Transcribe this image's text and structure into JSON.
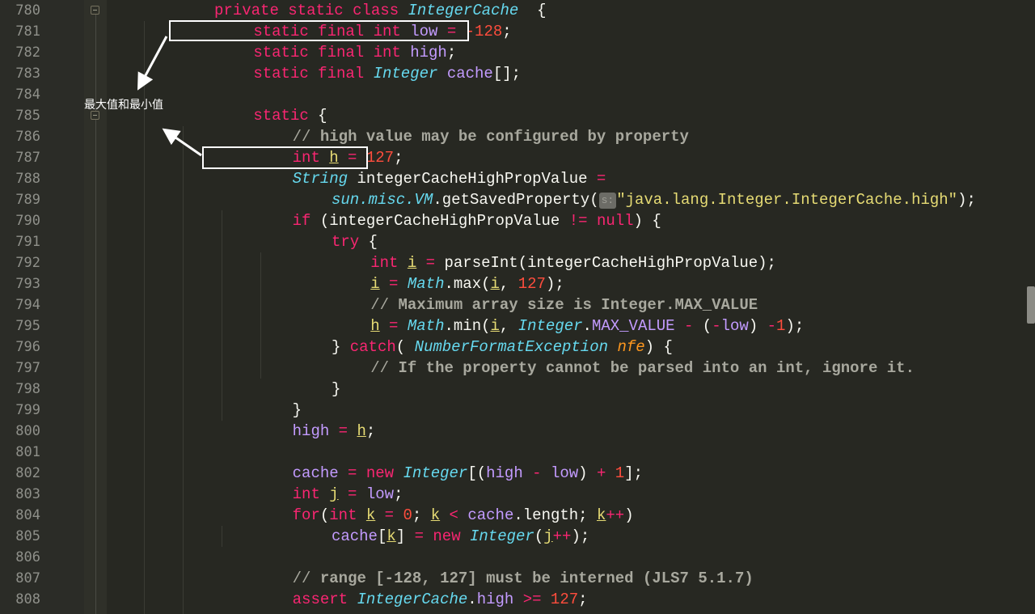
{
  "editor": {
    "first_line": 780,
    "annotation": "最大值和最小值",
    "lines": [
      {
        "n": "780",
        "ind": 7,
        "t": [
          [
            "kw",
            "private "
          ],
          [
            "kw",
            "static "
          ],
          [
            "kw",
            "class "
          ],
          [
            "ty",
            "IntegerCache"
          ],
          [
            "",
            "  {"
          ]
        ]
      },
      {
        "n": "781",
        "ind": 9,
        "t": [
          [
            "kw",
            "static "
          ],
          [
            "kw",
            "final "
          ],
          [
            "kw",
            "int "
          ],
          [
            "fld",
            "low"
          ],
          [
            "op",
            " = "
          ],
          [
            "num",
            "-128"
          ],
          [
            "",
            ";"
          ]
        ]
      },
      {
        "n": "782",
        "ind": 9,
        "t": [
          [
            "kw",
            "static "
          ],
          [
            "kw",
            "final "
          ],
          [
            "kw",
            "int "
          ],
          [
            "fld",
            "high"
          ],
          [
            "",
            ";"
          ]
        ]
      },
      {
        "n": "783",
        "ind": 9,
        "t": [
          [
            "kw",
            "static "
          ],
          [
            "kw",
            "final "
          ],
          [
            "ty",
            "Integer"
          ],
          [
            "",
            " "
          ],
          [
            "fld",
            "cache"
          ],
          [
            "",
            "[];"
          ]
        ]
      },
      {
        "n": "784",
        "ind": 0,
        "t": []
      },
      {
        "n": "785",
        "ind": 9,
        "t": [
          [
            "kw",
            "static"
          ],
          [
            "",
            " {"
          ]
        ]
      },
      {
        "n": "786",
        "ind": 11,
        "t": [
          [
            "cm-sl",
            "// "
          ],
          [
            "cm",
            "high value may be configured by property"
          ]
        ]
      },
      {
        "n": "787",
        "ind": 11,
        "t": [
          [
            "kw",
            "int "
          ],
          [
            "loc",
            "h"
          ],
          [
            "op",
            " = "
          ],
          [
            "num",
            "127"
          ],
          [
            "",
            ";"
          ]
        ]
      },
      {
        "n": "788",
        "ind": 11,
        "t": [
          [
            "ty",
            "String"
          ],
          [
            "",
            " integerCacheHighPropValue "
          ],
          [
            "op",
            "="
          ]
        ]
      },
      {
        "n": "789",
        "ind": 13,
        "t": [
          [
            "ty",
            "sun.misc.VM"
          ],
          [
            "",
            ".getSavedProperty("
          ],
          [
            "hint",
            "s:"
          ],
          [
            "str",
            "\"java.lang.Integer.IntegerCache.high\""
          ],
          [
            "",
            ");"
          ]
        ]
      },
      {
        "n": "790",
        "ind": 11,
        "t": [
          [
            "kw",
            "if"
          ],
          [
            "",
            " (integerCacheHighPropValue "
          ],
          [
            "op",
            "!="
          ],
          [
            "",
            " "
          ],
          [
            "kw",
            "null"
          ],
          [
            "",
            ") {"
          ]
        ]
      },
      {
        "n": "791",
        "ind": 13,
        "t": [
          [
            "kw",
            "try"
          ],
          [
            "",
            " {"
          ]
        ]
      },
      {
        "n": "792",
        "ind": 15,
        "t": [
          [
            "kw",
            "int "
          ],
          [
            "loc",
            "i"
          ],
          [
            "op",
            " = "
          ],
          [
            "",
            "parseInt(integerCacheHighPropValue);"
          ]
        ]
      },
      {
        "n": "793",
        "ind": 15,
        "t": [
          [
            "loc",
            "i"
          ],
          [
            "op",
            " = "
          ],
          [
            "ty",
            "Math"
          ],
          [
            "",
            ".max("
          ],
          [
            "loc",
            "i"
          ],
          [
            "",
            ", "
          ],
          [
            "num",
            "127"
          ],
          [
            "",
            ");"
          ]
        ]
      },
      {
        "n": "794",
        "ind": 15,
        "t": [
          [
            "cm-sl",
            "// "
          ],
          [
            "cm",
            "Maximum array size is Integer.MAX_VALUE"
          ]
        ]
      },
      {
        "n": "795",
        "ind": 15,
        "t": [
          [
            "loc",
            "h"
          ],
          [
            "op",
            " = "
          ],
          [
            "ty",
            "Math"
          ],
          [
            "",
            ".min("
          ],
          [
            "loc",
            "i"
          ],
          [
            "",
            ", "
          ],
          [
            "ty",
            "Integer"
          ],
          [
            "",
            "."
          ],
          [
            "fld",
            "MAX_VALUE"
          ],
          [
            "op",
            " - "
          ],
          [
            "",
            "("
          ],
          [
            "op",
            "-"
          ],
          [
            "fld",
            "low"
          ],
          [
            "",
            ") "
          ],
          [
            "op",
            "-"
          ],
          [
            "num",
            "1"
          ],
          [
            "",
            ");"
          ]
        ]
      },
      {
        "n": "796",
        "ind": 13,
        "t": [
          [
            "",
            "} "
          ],
          [
            "kw",
            "catch"
          ],
          [
            "",
            "( "
          ],
          [
            "ty",
            "NumberFormatException"
          ],
          [
            "",
            " "
          ],
          [
            "par",
            "nfe"
          ],
          [
            "",
            ") {"
          ]
        ]
      },
      {
        "n": "797",
        "ind": 15,
        "t": [
          [
            "cm-sl",
            "// "
          ],
          [
            "cm",
            "If the property cannot be parsed into an int, ignore it."
          ]
        ]
      },
      {
        "n": "798",
        "ind": 13,
        "t": [
          [
            "",
            "}"
          ]
        ]
      },
      {
        "n": "799",
        "ind": 11,
        "t": [
          [
            "",
            "}"
          ]
        ]
      },
      {
        "n": "800",
        "ind": 11,
        "t": [
          [
            "fld",
            "high"
          ],
          [
            "op",
            " = "
          ],
          [
            "loc",
            "h"
          ],
          [
            "",
            ";"
          ]
        ]
      },
      {
        "n": "801",
        "ind": 0,
        "t": []
      },
      {
        "n": "802",
        "ind": 11,
        "t": [
          [
            "fld",
            "cache"
          ],
          [
            "op",
            " = "
          ],
          [
            "kw",
            "new "
          ],
          [
            "ty",
            "Integer"
          ],
          [
            "",
            "[("
          ],
          [
            "fld",
            "high"
          ],
          [
            "op",
            " - "
          ],
          [
            "fld",
            "low"
          ],
          [
            "",
            ") "
          ],
          [
            "op",
            "+ "
          ],
          [
            "num",
            "1"
          ],
          [
            "",
            "];"
          ]
        ]
      },
      {
        "n": "803",
        "ind": 11,
        "t": [
          [
            "kw",
            "int "
          ],
          [
            "loc",
            "j"
          ],
          [
            "op",
            " = "
          ],
          [
            "fld",
            "low"
          ],
          [
            "",
            ";"
          ]
        ]
      },
      {
        "n": "804",
        "ind": 11,
        "t": [
          [
            "kw",
            "for"
          ],
          [
            "",
            "("
          ],
          [
            "kw",
            "int "
          ],
          [
            "loc",
            "k"
          ],
          [
            "op",
            " = "
          ],
          [
            "num",
            "0"
          ],
          [
            "",
            "; "
          ],
          [
            "loc",
            "k"
          ],
          [
            "op",
            " < "
          ],
          [
            "fld",
            "cache"
          ],
          [
            "",
            ".length; "
          ],
          [
            "loc",
            "k"
          ],
          [
            "op",
            "++"
          ],
          [
            "",
            ")"
          ]
        ]
      },
      {
        "n": "805",
        "ind": 13,
        "t": [
          [
            "fld",
            "cache"
          ],
          [
            "",
            "["
          ],
          [
            "loc",
            "k"
          ],
          [
            "",
            "] "
          ],
          [
            "op",
            "= "
          ],
          [
            "kw",
            "new "
          ],
          [
            "ty",
            "Integer"
          ],
          [
            "",
            "("
          ],
          [
            "loc",
            "j"
          ],
          [
            "op",
            "++"
          ],
          [
            "",
            ");"
          ]
        ]
      },
      {
        "n": "806",
        "ind": 0,
        "t": []
      },
      {
        "n": "807",
        "ind": 11,
        "t": [
          [
            "cm-sl",
            "// "
          ],
          [
            "cm",
            "range [-128, 127] must be interned (JLS7 5.1.7)"
          ]
        ]
      },
      {
        "n": "808",
        "ind": 11,
        "t": [
          [
            "kw",
            "assert "
          ],
          [
            "ty",
            "IntegerCache"
          ],
          [
            "",
            "."
          ],
          [
            "fld",
            "high"
          ],
          [
            "op",
            " >= "
          ],
          [
            "num",
            "127"
          ],
          [
            "",
            ";"
          ]
        ]
      }
    ]
  }
}
